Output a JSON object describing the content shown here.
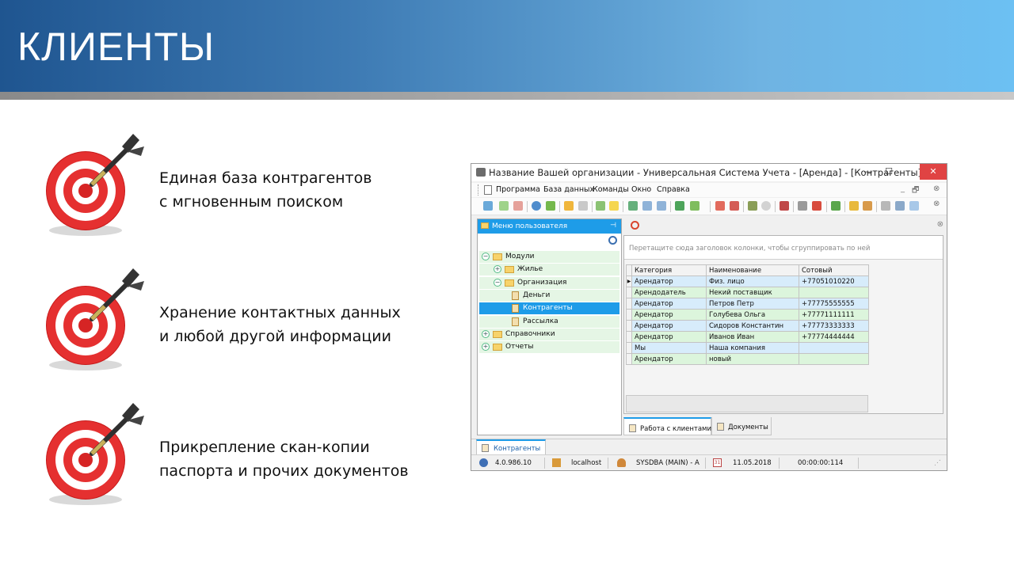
{
  "slide": {
    "title": "КЛИЕНТЫ",
    "bullets": [
      {
        "line1": "Единая база контрагентов",
        "line2": "с мгновенным поиском"
      },
      {
        "line1": "Хранение контактных данных",
        "line2": "и любой другой информации"
      },
      {
        "line1": "Прикрепление скан-копии",
        "line2": "паспорта и прочих документов"
      }
    ]
  },
  "window": {
    "title": "Название Вашей организации - Универсальная Система Учета - [Аренда] - [Контрагенты]",
    "controls": {
      "minimize": "—",
      "maximize": "☐",
      "close": "✕"
    },
    "menu": [
      "Программа",
      "База данных",
      "Команды",
      "Окно",
      "Справка"
    ],
    "menu_controls": [
      "_",
      "🗗",
      "⊗"
    ],
    "left_panel": {
      "header": "Меню пользователя",
      "pin": "⊣",
      "tree": [
        {
          "label": "Модули",
          "level": 0,
          "type": "folder",
          "exp": "−"
        },
        {
          "label": "Жилье",
          "level": 1,
          "type": "folder",
          "exp": "+"
        },
        {
          "label": "Организация",
          "level": 1,
          "type": "folder",
          "exp": "−"
        },
        {
          "label": "Деньги",
          "level": 2,
          "type": "doc"
        },
        {
          "label": "Контрагенты",
          "level": 2,
          "type": "doc",
          "selected": true
        },
        {
          "label": "Рассылка",
          "level": 2,
          "type": "doc"
        },
        {
          "label": "Справочники",
          "level": 0,
          "type": "folder",
          "exp": "+"
        },
        {
          "label": "Отчеты",
          "level": 0,
          "type": "folder",
          "exp": "+"
        }
      ]
    },
    "grid": {
      "group_hint": "Перетащите сюда заголовок колонки, чтобы сгруппировать по ней",
      "columns": [
        "Категория",
        "Наименование",
        "Сотовый"
      ],
      "rows": [
        [
          "Арендатор",
          "Физ. лицо",
          "+77051010220"
        ],
        [
          "Арендодатель",
          "Некий поставщик",
          ""
        ],
        [
          "Арендатор",
          "Петров Петр",
          "+77775555555"
        ],
        [
          "Арендатор",
          "Голубева Ольга",
          "+77771111111"
        ],
        [
          "Арендатор",
          "Сидоров Константин",
          "+77773333333"
        ],
        [
          "Арендатор",
          "Иванов Иван",
          "+77774444444"
        ],
        [
          "Мы",
          "Наша компания",
          ""
        ],
        [
          "Арендатор",
          "новый",
          ""
        ]
      ],
      "current_row_marker": "▶"
    },
    "right_tabs": [
      "Работа с клиентами",
      "Документы"
    ],
    "doc_tab": "Контрагенты",
    "status": {
      "version": "4.0.986.10",
      "server": "localhost",
      "user": "SYSDBA (MAIN) - A",
      "date": "11.05.2018",
      "timer": "00:00:00:114",
      "calendar_day": "31"
    }
  },
  "colors": {
    "header_start": "#1f5590",
    "header_end": "#6cc0f3",
    "accent": "#1e9ce8",
    "row_even": "#d7ecfb",
    "row_odd": "#dcf5dc"
  }
}
